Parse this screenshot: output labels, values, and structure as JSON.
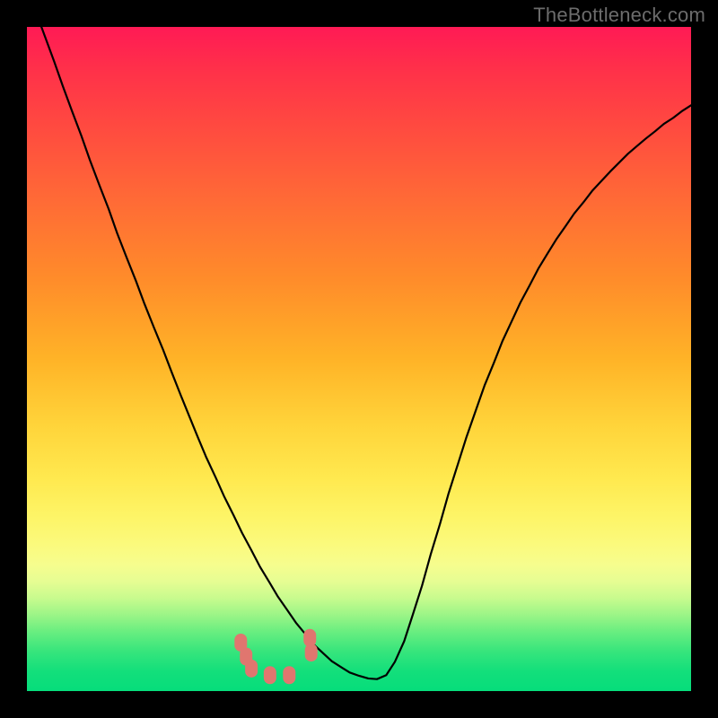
{
  "watermark": "TheBottleneck.com",
  "colors": {
    "black": "#000000",
    "marker": "#e0766f",
    "curve": "#000000"
  },
  "chart_data": {
    "type": "line",
    "title": "",
    "xlabel": "",
    "ylabel": "",
    "x": [
      0.0,
      0.013,
      0.027,
      0.041,
      0.054,
      0.068,
      0.082,
      0.095,
      0.109,
      0.123,
      0.136,
      0.15,
      0.164,
      0.177,
      0.191,
      0.205,
      0.218,
      0.231,
      0.244,
      0.257,
      0.27,
      0.284,
      0.297,
      0.311,
      0.324,
      0.338,
      0.351,
      0.365,
      0.378,
      0.392,
      0.405,
      0.419,
      0.432,
      0.446,
      0.459,
      0.473,
      0.486,
      0.5,
      0.514,
      0.527,
      0.541,
      0.554,
      0.568,
      0.581,
      0.595,
      0.608,
      0.622,
      0.635,
      0.649,
      0.662,
      0.676,
      0.689,
      0.703,
      0.716,
      0.73,
      0.743,
      0.757,
      0.77,
      0.784,
      0.797,
      0.811,
      0.824,
      0.838,
      0.851,
      0.865,
      0.878,
      0.892,
      0.905,
      0.919,
      0.932,
      0.946,
      0.959,
      0.973,
      0.986,
      1.0
    ],
    "values": [
      1.062,
      1.024,
      0.986,
      0.948,
      0.911,
      0.873,
      0.836,
      0.799,
      0.762,
      0.726,
      0.689,
      0.653,
      0.618,
      0.583,
      0.548,
      0.514,
      0.48,
      0.447,
      0.415,
      0.383,
      0.352,
      0.322,
      0.293,
      0.265,
      0.238,
      0.212,
      0.187,
      0.164,
      0.142,
      0.122,
      0.103,
      0.086,
      0.07,
      0.057,
      0.045,
      0.036,
      0.028,
      0.023,
      0.019,
      0.018,
      0.024,
      0.044,
      0.075,
      0.115,
      0.159,
      0.206,
      0.252,
      0.298,
      0.342,
      0.383,
      0.423,
      0.46,
      0.494,
      0.527,
      0.557,
      0.585,
      0.611,
      0.636,
      0.659,
      0.68,
      0.7,
      0.719,
      0.736,
      0.753,
      0.768,
      0.782,
      0.796,
      0.809,
      0.821,
      0.832,
      0.843,
      0.854,
      0.863,
      0.873,
      0.882
    ],
    "xlim": [
      0,
      1
    ],
    "ylim": [
      0,
      1
    ],
    "markers": [
      {
        "x": 0.322,
        "y": 0.073
      },
      {
        "x": 0.33,
        "y": 0.052
      },
      {
        "x": 0.338,
        "y": 0.034
      },
      {
        "x": 0.366,
        "y": 0.024
      },
      {
        "x": 0.395,
        "y": 0.024
      },
      {
        "x": 0.426,
        "y": 0.08
      },
      {
        "x": 0.428,
        "y": 0.058
      }
    ],
    "background_gradient": [
      "#ff1a55",
      "#ff8c2a",
      "#ffe94f",
      "#06dd7b"
    ]
  }
}
